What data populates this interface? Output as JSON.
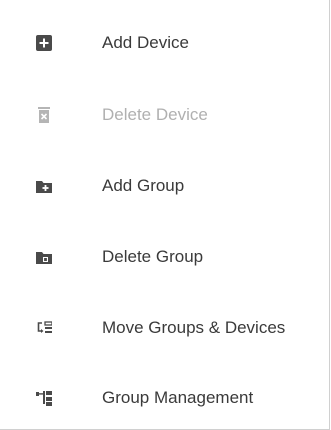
{
  "menu": {
    "items": [
      {
        "label": "Add Device",
        "icon": "add-device-icon",
        "disabled": false
      },
      {
        "label": "Delete Device",
        "icon": "delete-device-icon",
        "disabled": true
      },
      {
        "label": "Add Group",
        "icon": "add-group-icon",
        "disabled": false
      },
      {
        "label": "Delete Group",
        "icon": "delete-group-icon",
        "disabled": false
      },
      {
        "label": "Move Groups & Devices",
        "icon": "move-icon",
        "disabled": false
      },
      {
        "label": "Group Management",
        "icon": "group-management-icon",
        "disabled": false
      }
    ]
  },
  "colors": {
    "icon": "#4a4a4a",
    "icon_disabled": "#b5b5b5",
    "text": "#3a3a3a",
    "text_disabled": "#b0b0b0"
  }
}
